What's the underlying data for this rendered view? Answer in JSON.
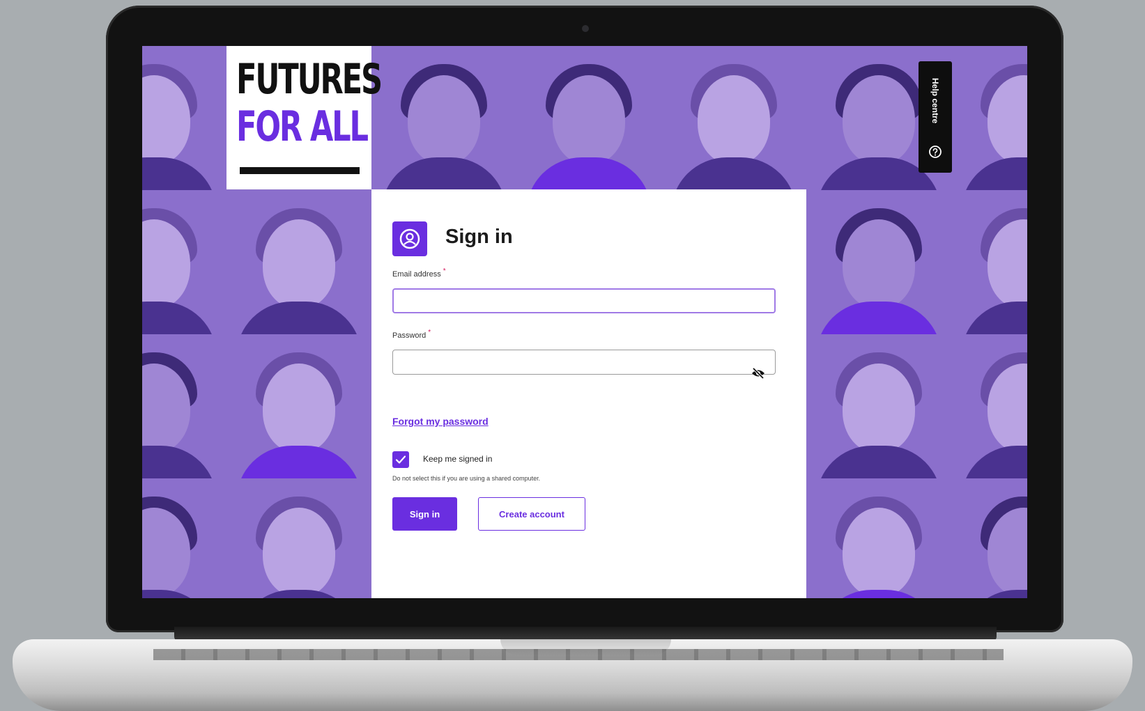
{
  "brand": {
    "logo_line1": "FUTURES",
    "logo_line2": "FOR ALL",
    "accent_color": "#6a2ee0"
  },
  "help": {
    "label": "Help centre",
    "icon": "help-circle-icon"
  },
  "signin": {
    "title": "Sign in",
    "title_icon": "user-circle-icon",
    "email_label": "Email address",
    "email_value": "",
    "password_label": "Password",
    "password_value": "",
    "password_toggle_icon": "eye-slash-icon",
    "required_marker": "*",
    "forgot_link": "Forgot my password",
    "keep_signed_in_label": "Keep me signed in",
    "keep_signed_in_checked": true,
    "keep_signed_in_hint": "Do not select this if you are using a shared computer.",
    "signin_button": "Sign in",
    "create_account_button": "Create account"
  }
}
